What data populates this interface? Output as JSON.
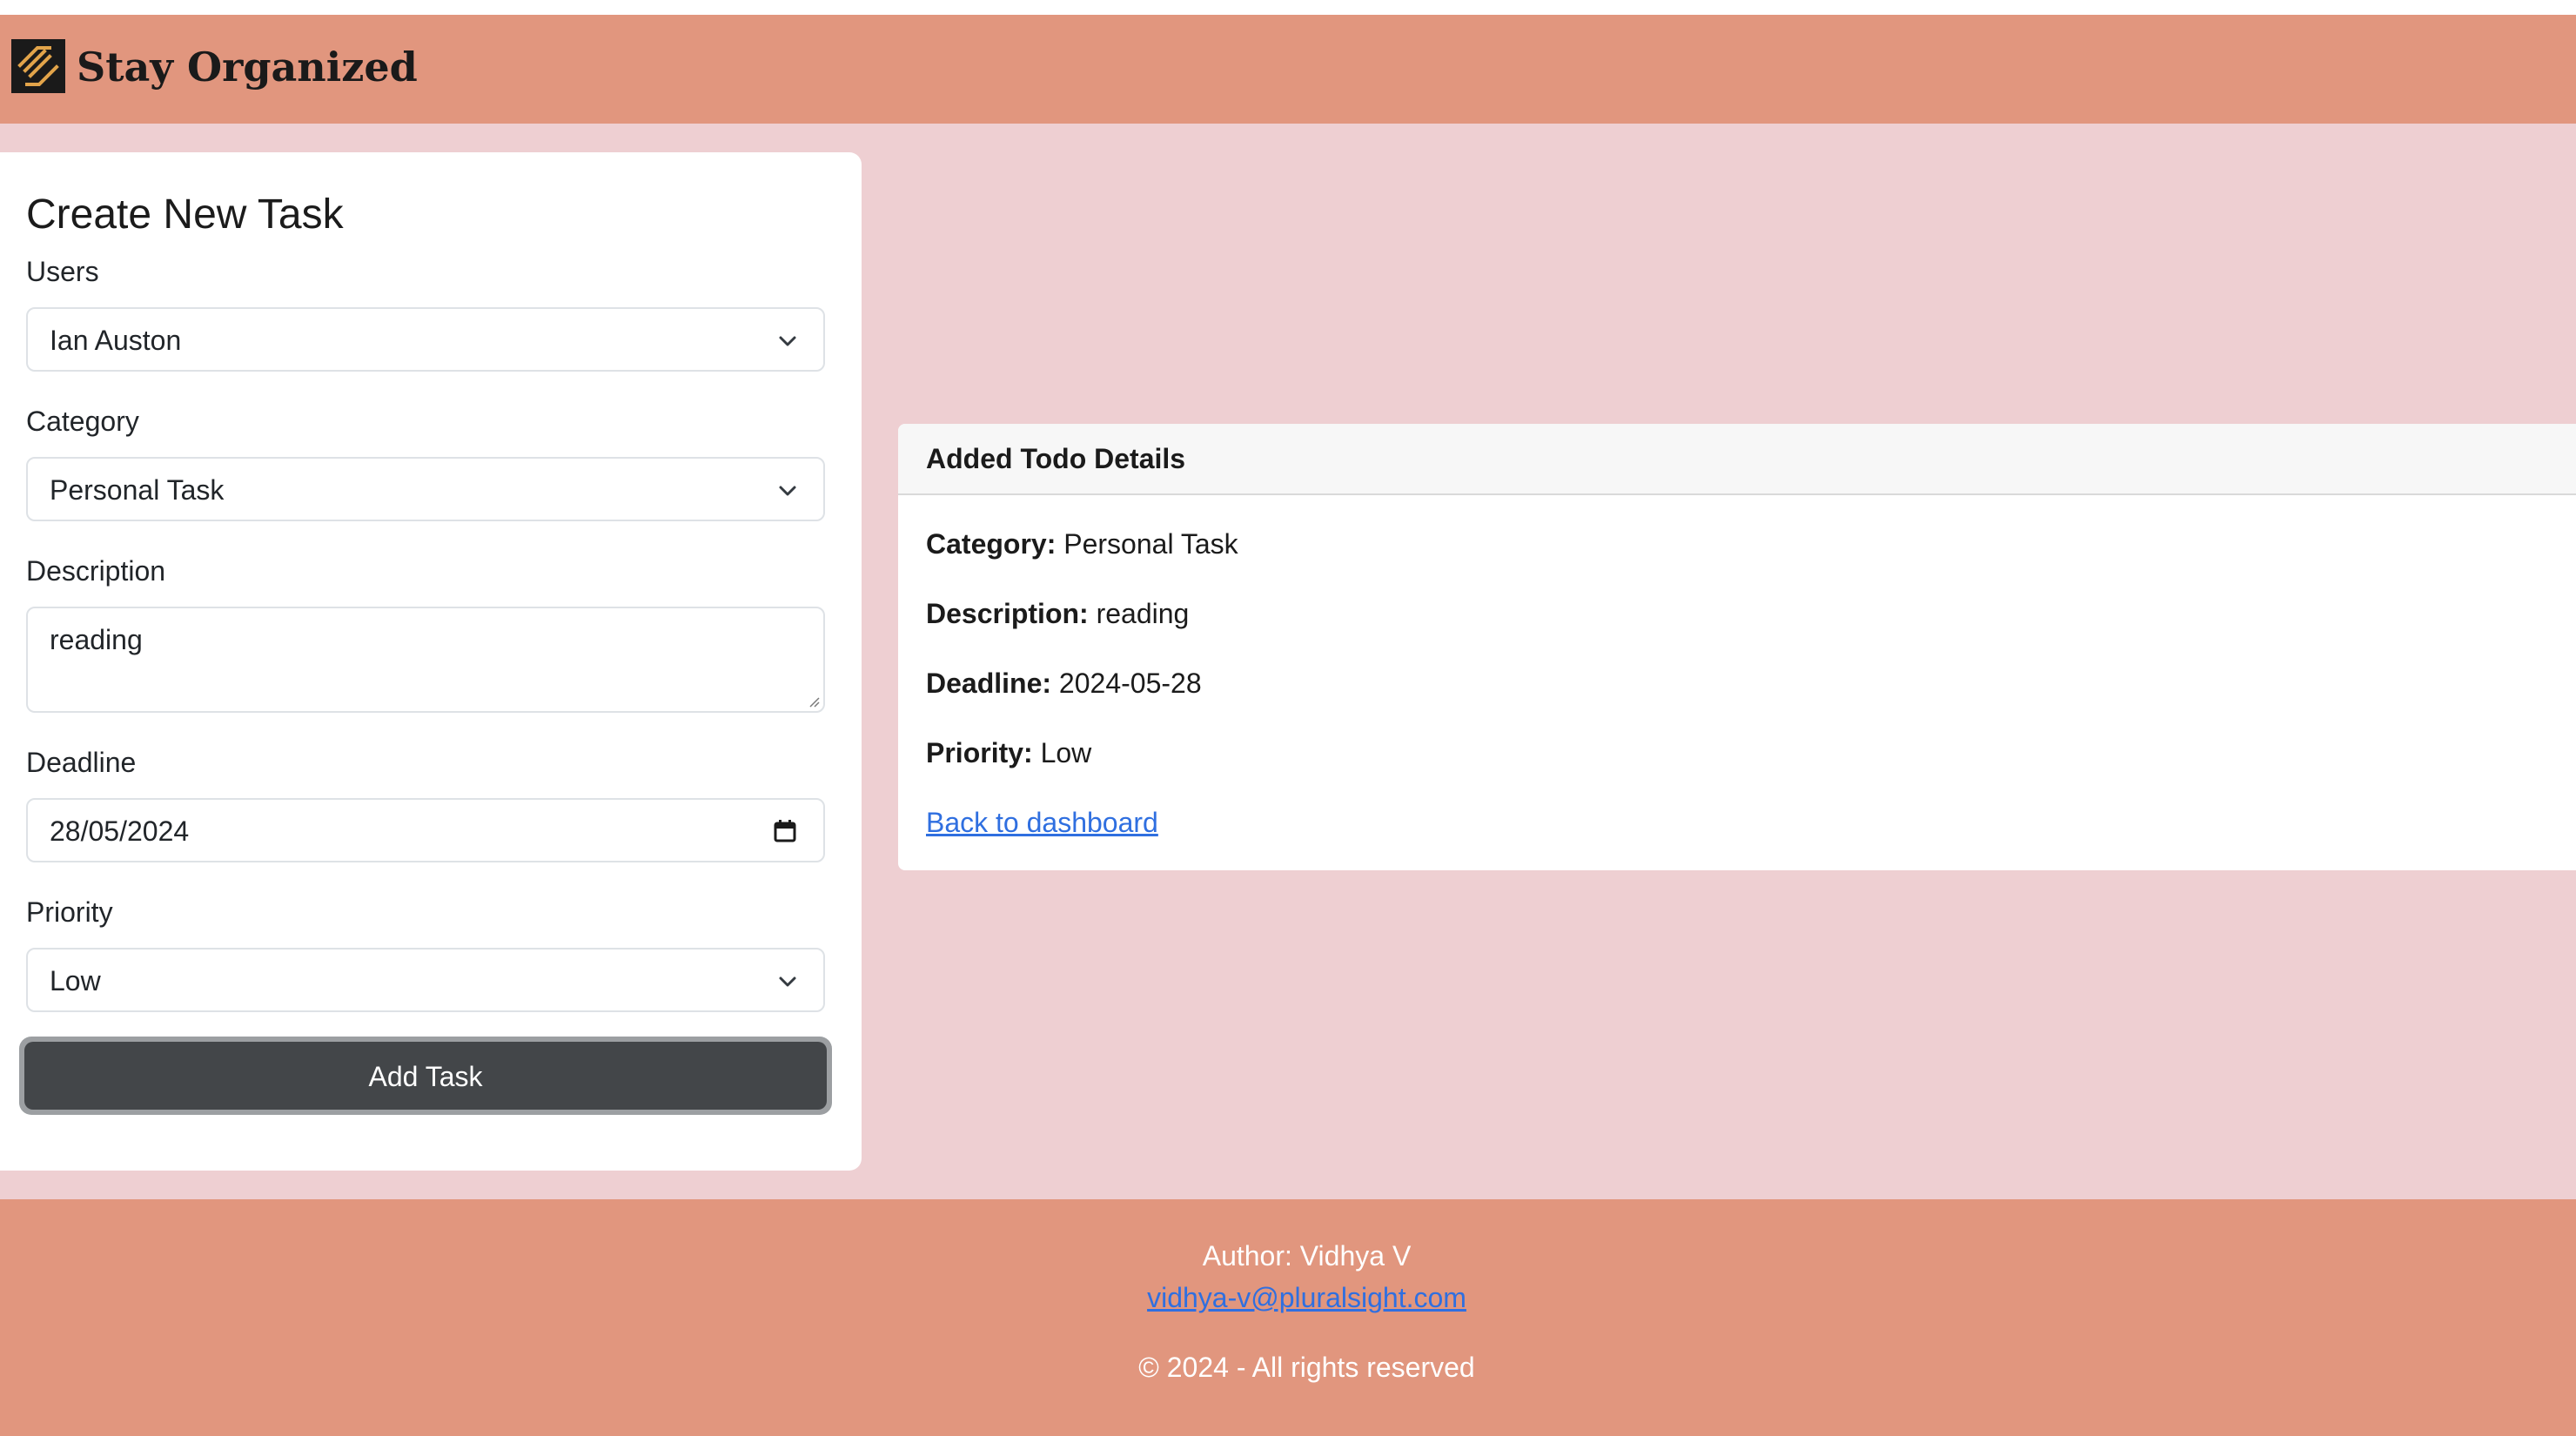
{
  "header": {
    "brand": "Stay Organized",
    "logo_icon": "layers-logo-icon"
  },
  "form": {
    "title": "Create New Task",
    "users": {
      "label": "Users",
      "value": "Ian Auston"
    },
    "category": {
      "label": "Category",
      "value": "Personal Task"
    },
    "description": {
      "label": "Description",
      "value": "reading"
    },
    "deadline": {
      "label": "Deadline",
      "value": "28/05/2024"
    },
    "priority": {
      "label": "Priority",
      "value": "Low"
    },
    "submit_label": "Add Task"
  },
  "details": {
    "title": "Added Todo Details",
    "category_label": "Category:",
    "category_value": "Personal Task",
    "description_label": "Description:",
    "description_value": "reading",
    "deadline_label": "Deadline:",
    "deadline_value": "2024-05-28",
    "priority_label": "Priority:",
    "priority_value": "Low",
    "back_link": "Back to dashboard"
  },
  "footer": {
    "author": "Author: Vidhya V",
    "email": "vidhya-v@pluralsight.com",
    "copyright": "© 2024 - All rights reserved"
  },
  "colors": {
    "header_bg": "#e1967e",
    "page_bg": "#eecfd2",
    "button_bg": "#434649",
    "link": "#2f6fe0"
  }
}
